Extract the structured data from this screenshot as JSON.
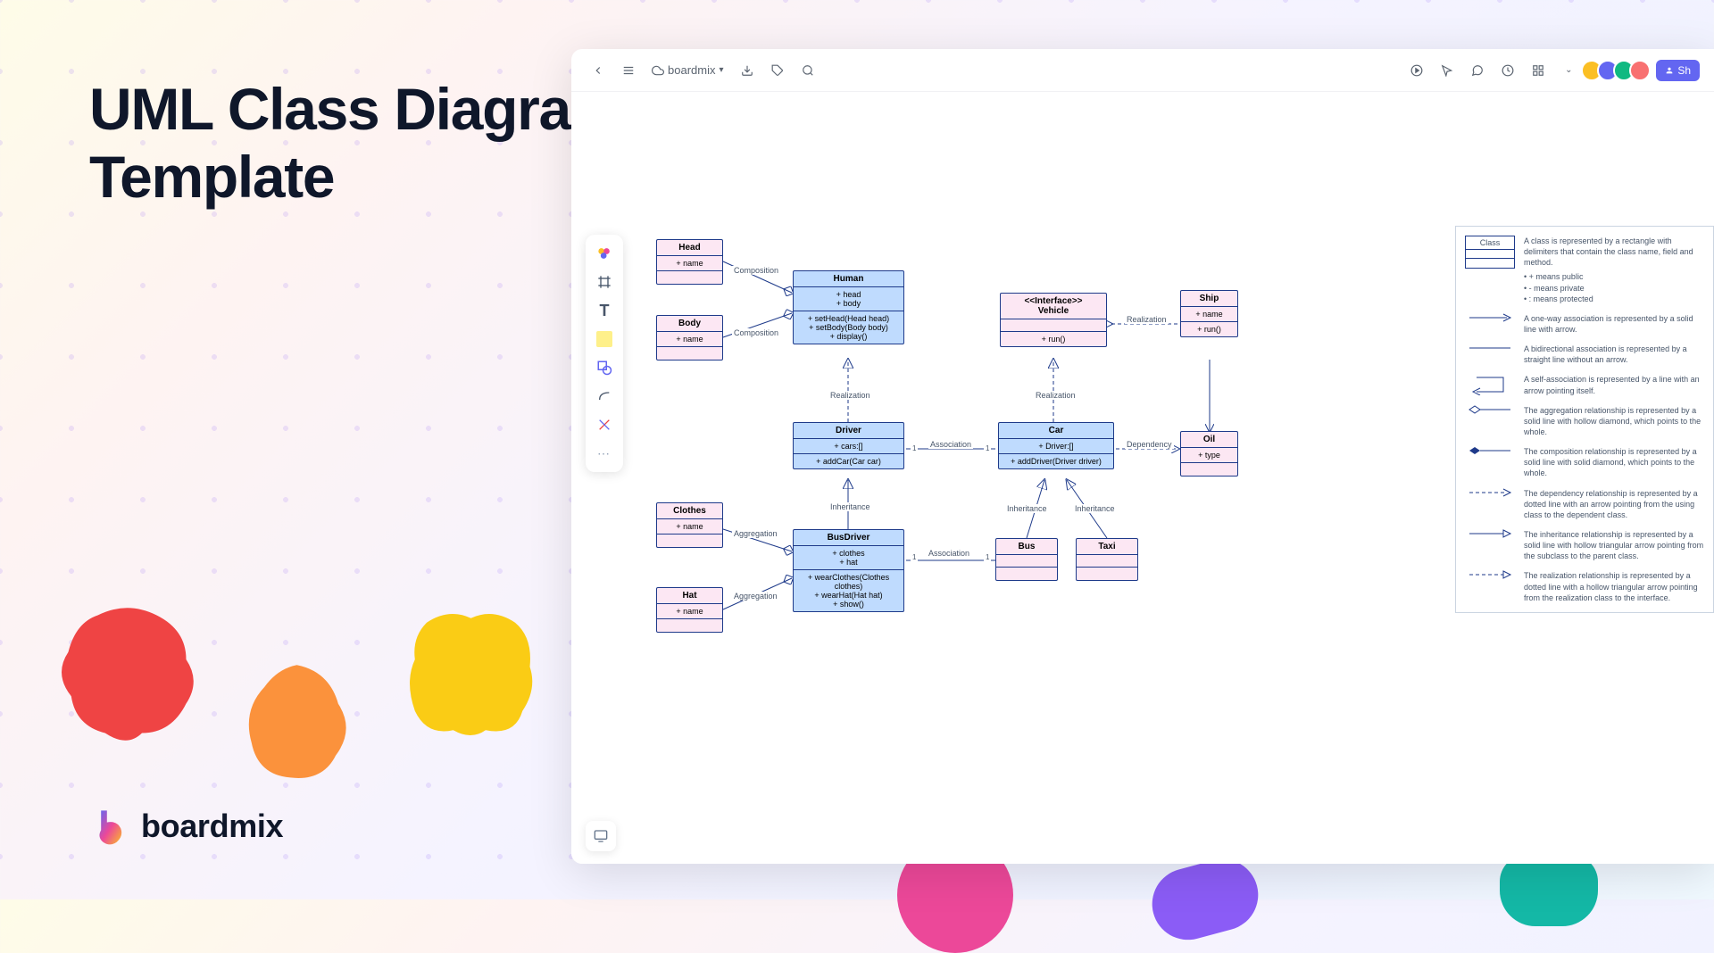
{
  "hero": {
    "title": "UML Class Diagram\nTemplate"
  },
  "brand": {
    "name": "boardmix"
  },
  "topbar": {
    "title": "boardmix",
    "share": "Sh"
  },
  "tools": [
    "logo",
    "frame",
    "text",
    "note",
    "shape",
    "line",
    "eraser"
  ],
  "classes": {
    "head": {
      "name": "Head",
      "attrs": "+ name"
    },
    "body": {
      "name": "Body",
      "attrs": "+ name"
    },
    "human": {
      "name": "Human",
      "attrs": "+ head\n+ body",
      "ops": "+ setHead(Head head)\n+ setBody(Body body)\n+ display()"
    },
    "driver": {
      "name": "Driver",
      "attrs": "+ cars:[]",
      "ops": "+ addCar(Car car)"
    },
    "busdriver": {
      "name": "BusDriver",
      "attrs": "+ clothes\n+ hat",
      "ops": "+ wearClothes(Clothes clothes)\n+ wearHat(Hat hat)\n+ show()"
    },
    "clothes": {
      "name": "Clothes",
      "attrs": "+ name"
    },
    "hat": {
      "name": "Hat",
      "attrs": "+ name"
    },
    "vehicle": {
      "name": "<<Interface>>\nVehicle",
      "ops": "+ run()"
    },
    "car": {
      "name": "Car",
      "attrs": "+ Driver:[]",
      "ops": "+ addDriver(Driver driver)"
    },
    "bus": {
      "name": "Bus"
    },
    "taxi": {
      "name": "Taxi"
    },
    "ship": {
      "name": "Ship",
      "attrs": "+ name",
      "ops": "+ run()"
    },
    "oil": {
      "name": "Oil",
      "attrs": "+ type"
    }
  },
  "relations": {
    "composition": "Composition",
    "realization": "Realization",
    "aggregation": "Aggregation",
    "association": "Association",
    "inheritance": "Inheritance",
    "dependency": "Dependency"
  },
  "legend": {
    "class_name": "Class",
    "class_desc": "A class is represented by a rectangle with delimiters that contain the class name, field and method.",
    "bullet1": "+ means public",
    "bullet2": "- means private",
    "bullet3": ": means protected",
    "assoc_oneway": "A one-way association is represented by a solid line with arrow.",
    "assoc_bidir": "A bidirectional association is represented by a straight line without an arrow.",
    "assoc_self": "A self-association is represented by a line with an arrow pointing itself.",
    "aggregation": "The aggregation relationship is represented by a solid line with hollow diamond, which points to the whole.",
    "composition": "The composition relationship is represented by a solid line with solid diamond, which points to the whole.",
    "dependency": "The dependency relationship is represented by a dotted line with an arrow pointing from the using class to the dependent class.",
    "inheritance": "The inheritance relationship is represented by a solid line with hollow triangular arrow pointing from the subclass to the parent class.",
    "realization": "The realization relationship is represented by a dotted line with a hollow triangular arrow pointing from the realization class to the interface."
  }
}
